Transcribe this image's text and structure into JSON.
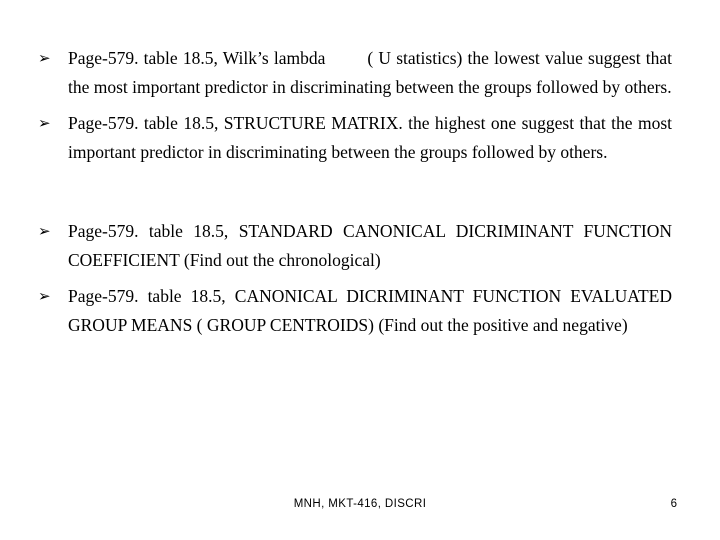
{
  "slide": {
    "background_color": "#ffffff",
    "text_color": "#000000",
    "bullet_glyph": "➢",
    "bullets": [
      {
        "id": "bullet-wilks-lambda",
        "text_before_gap": "Page-579. table 18.5, Wilk’s lambda",
        "text_after_gap": "( U  statistics) the lowest value suggest that the most important predictor in discriminating between the groups followed by others."
      },
      {
        "id": "bullet-structure-matrix",
        "text": "Page-579. table 18.5, STRUCTURE MATRIX. the highest one suggest that the most important predictor in discriminating between the groups followed by others."
      },
      {
        "id": "bullet-standard-canonical",
        "text": "Page-579. table  18.5,  STANDARD  CANONICAL  DICRIMINANT FUNCTION COEFFICIENT (Find out the chronological)"
      },
      {
        "id": "bullet-canonical-centroids",
        "text": "Page-579. table  18.5,  CANONICAL  DICRIMINANT  FUNCTION EVALUATED GROUP MEANS ( GROUP CENTROIDS) (Find out the positive and negative)"
      }
    ]
  },
  "footer": {
    "course_label": "MNH, MKT-416, DISCRI",
    "page_number": "6"
  }
}
